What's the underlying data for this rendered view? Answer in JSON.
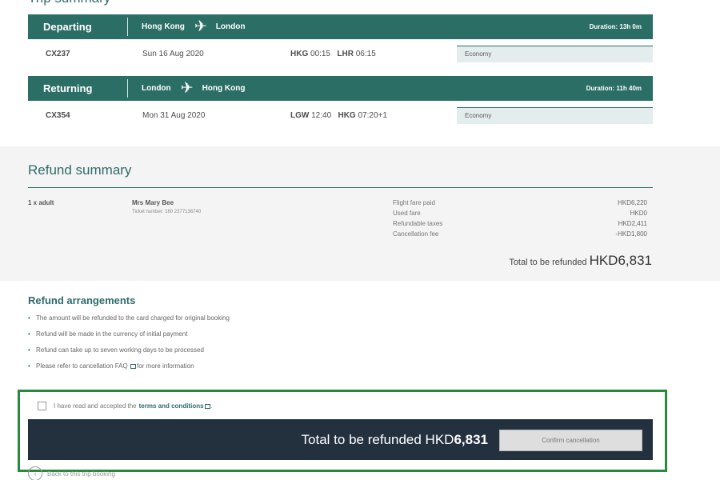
{
  "trip_summary": {
    "title": "Trip summary",
    "departing": {
      "label": "Departing",
      "from": "Hong Kong",
      "to": "London",
      "duration_label": "Duration:",
      "duration": "13h 0m",
      "flight": "CX237",
      "date": "Sun 16 Aug 2020",
      "dep_code": "HKG",
      "dep_time": "00:15",
      "arr_code": "LHR",
      "arr_time": "06:15",
      "cabin": "Economy"
    },
    "returning": {
      "label": "Returning",
      "from": "London",
      "to": "Hong Kong",
      "duration_label": "Duration:",
      "duration": "11h 40m",
      "flight": "CX354",
      "date": "Mon 31 Aug 2020",
      "dep_code": "LGW",
      "dep_time": "12:40",
      "arr_code": "HKG",
      "arr_time": "07:20+1",
      "cabin": "Economy"
    },
    "plane_icon": "plane-icon"
  },
  "refund_summary": {
    "title": "Refund summary",
    "passenger_count": "1 x adult",
    "passenger_name": "Mrs Mary Bee",
    "ticket_number": "Ticket number: 160 2377136740",
    "lines": [
      {
        "label": "Flight fare paid",
        "value": "HKD6,220"
      },
      {
        "label": "Used fare",
        "value": "HKD0"
      },
      {
        "label": "Refundable taxes",
        "value": "HKD2,411"
      },
      {
        "label": "Cancellation fee",
        "value": "-HKD1,800"
      }
    ],
    "total_label": "Total to be refunded",
    "total_amount": "HKD6,831"
  },
  "refund_arrangements": {
    "title": "Refund arrangements",
    "items": [
      "The amount will be refunded to the card charged for original booking",
      "Refund will be made in the currency of initial payment",
      "Refund can take up to seven working days to be processed"
    ],
    "faq_prefix": "Please refer to cancellation FAQ",
    "faq_suffix": "for more information"
  },
  "confirmation": {
    "terms_prefix": "I have read and accepted the",
    "terms_link": "terms and conditions",
    "terms_end": ".",
    "total_label": "Total to be refunded HKD",
    "total_amount": "6,831",
    "confirm_button": "Confirm cancellation",
    "back_link": "Back to this trip booking",
    "highlight_color": "#2a8a3c",
    "bar_color": "#23313f"
  },
  "colors": {
    "accent": "#2b6e66",
    "title": "#2f6a6a"
  }
}
